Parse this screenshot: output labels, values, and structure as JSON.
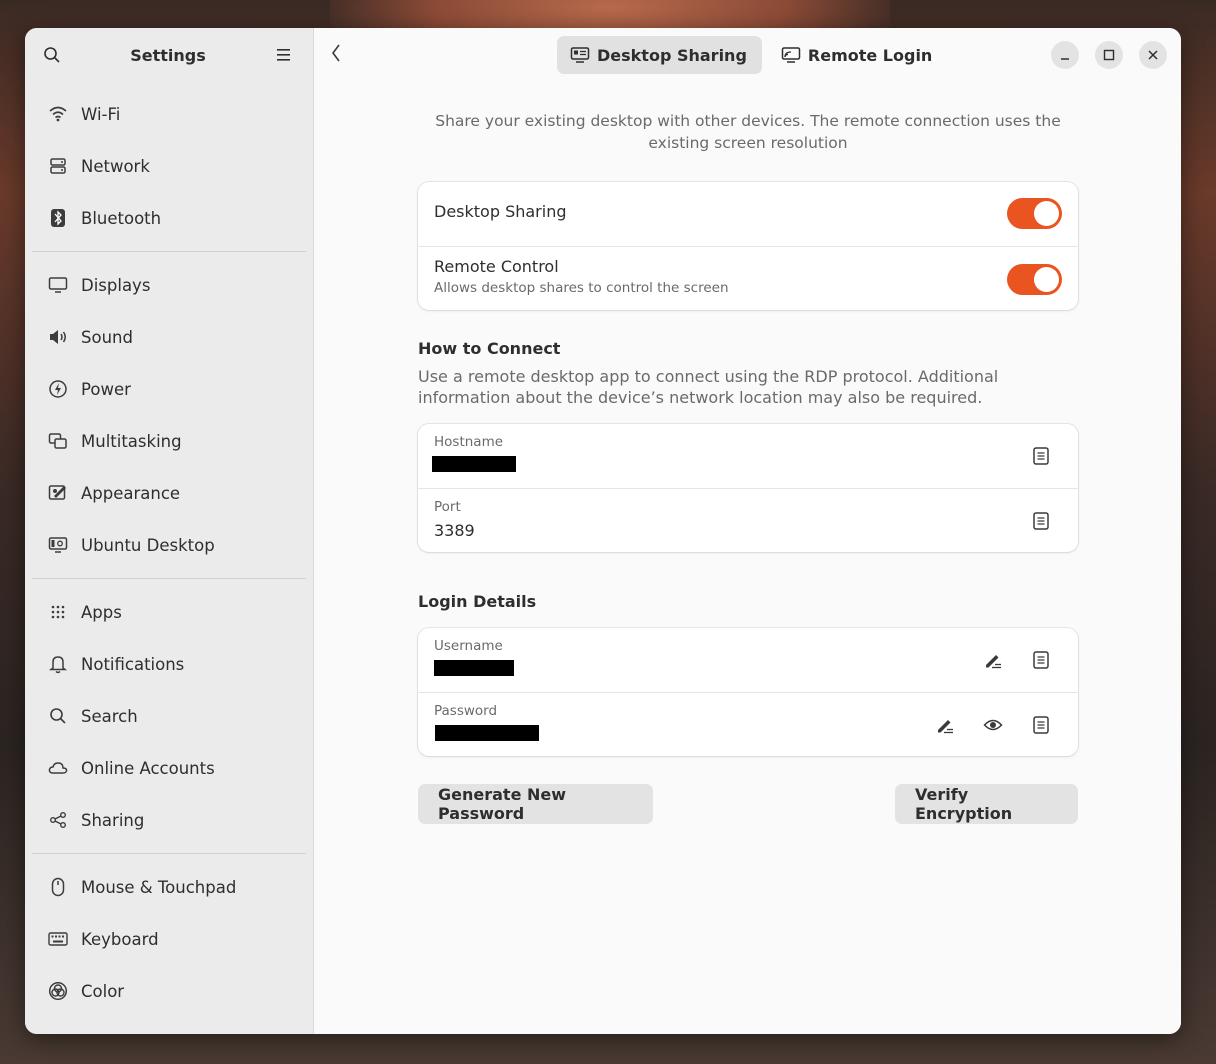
{
  "sidebar": {
    "title": "Settings",
    "items": [
      {
        "label": "Wi-Fi",
        "icon": "wifi-icon"
      },
      {
        "label": "Network",
        "icon": "network-icon"
      },
      {
        "label": "Bluetooth",
        "icon": "bluetooth-icon"
      },
      {
        "label": "Displays",
        "icon": "display-icon"
      },
      {
        "label": "Sound",
        "icon": "speaker-icon"
      },
      {
        "label": "Power",
        "icon": "power-icon"
      },
      {
        "label": "Multitasking",
        "icon": "multitasking-icon"
      },
      {
        "label": "Appearance",
        "icon": "appearance-icon"
      },
      {
        "label": "Ubuntu Desktop",
        "icon": "ubuntu-desktop-icon"
      },
      {
        "label": "Apps",
        "icon": "apps-grid-icon"
      },
      {
        "label": "Notifications",
        "icon": "bell-icon"
      },
      {
        "label": "Search",
        "icon": "search-icon"
      },
      {
        "label": "Online Accounts",
        "icon": "cloud-icon"
      },
      {
        "label": "Sharing",
        "icon": "share-icon"
      },
      {
        "label": "Mouse & Touchpad",
        "icon": "mouse-icon"
      },
      {
        "label": "Keyboard",
        "icon": "keyboard-icon"
      },
      {
        "label": "Color",
        "icon": "color-icon"
      }
    ]
  },
  "header": {
    "tabs": [
      {
        "label": "Desktop Sharing",
        "active": true
      },
      {
        "label": "Remote Login",
        "active": false
      }
    ]
  },
  "main": {
    "intro": "Share your existing desktop with other devices. The remote connection uses the existing screen resolution",
    "desktop_sharing_label": "Desktop Sharing",
    "desktop_sharing_on": true,
    "remote_control_label": "Remote Control",
    "remote_control_sub": "Allows desktop shares to control the screen",
    "remote_control_on": true,
    "how_to_connect": {
      "title": "How to Connect",
      "desc": "Use a remote desktop app to connect using the RDP protocol. Additional information about the device’s network location may also be required.",
      "hostname_label": "Hostname",
      "port_label": "Port",
      "port_value": "3389"
    },
    "login_details": {
      "title": "Login Details",
      "username_label": "Username",
      "password_label": "Password"
    },
    "generate_button": "Generate New Password",
    "verify_button": "Verify Encryption"
  },
  "colors": {
    "accent": "#e95420"
  }
}
